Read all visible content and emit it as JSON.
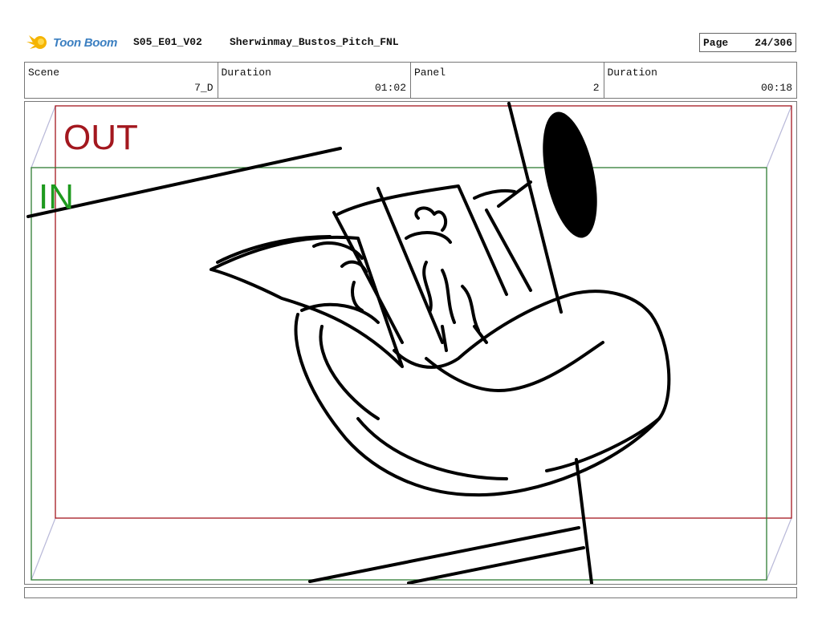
{
  "header": {
    "logo_text": "Toon Boom",
    "project_code": "S05_E01_V02",
    "project_name": "Sherwinmay_Bustos_Pitch_FNL",
    "page_label": "Page",
    "page_value": "24/306"
  },
  "info": {
    "scene_label": "Scene",
    "scene_value": "7_D",
    "scene_duration_label": "Duration",
    "scene_duration_value": "01:02",
    "panel_label": "Panel",
    "panel_value": "2",
    "panel_duration_label": "Duration",
    "panel_duration_value": "00:18"
  },
  "panel": {
    "out_label": "OUT",
    "in_label": "IN",
    "out_color": "#a3171e",
    "in_color": "#1f9a1f"
  },
  "footer": {
    "caption": ""
  }
}
